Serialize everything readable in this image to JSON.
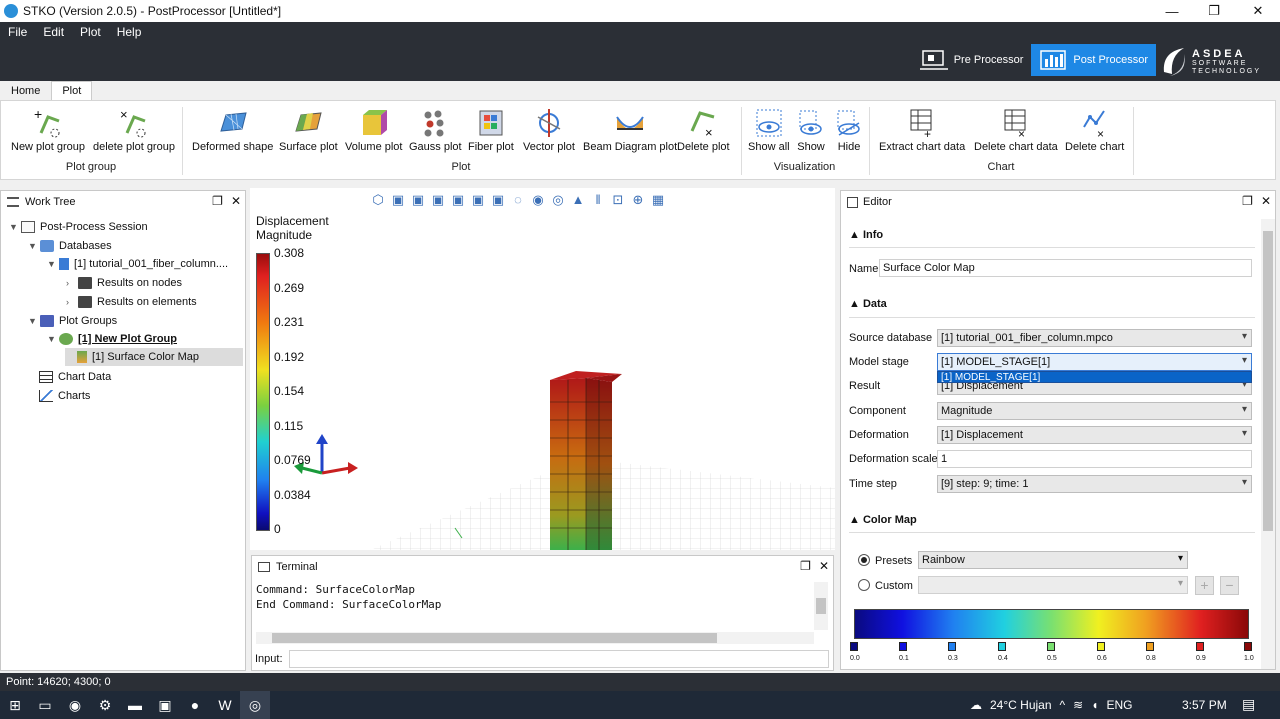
{
  "window": {
    "title": "STKO (Version 2.0.5) - PostProcessor [Untitled*]",
    "min": "—",
    "max": "❐",
    "close": "✕"
  },
  "menu": [
    "File",
    "Edit",
    "Plot",
    "Help"
  ],
  "modes": {
    "pre": "Pre Processor",
    "post": "Post Processor"
  },
  "logo": {
    "brand": "ASDEA",
    "line1": "SOFTWARE",
    "line2": "TECHNOLOGY"
  },
  "ribbon_tabs": [
    "Home",
    "Plot"
  ],
  "ribbon": {
    "groups": [
      "Plot group",
      "Plot",
      "Visualization",
      "Chart"
    ],
    "buttons": [
      "New plot group",
      "delete plot group",
      "Deformed shape",
      "Surface plot",
      "Volume plot",
      "Gauss plot",
      "Fiber plot",
      "Vector plot",
      "Beam Diagram plot",
      "Delete plot",
      "Show all",
      "Show",
      "Hide",
      "Extract chart data",
      "Delete chart data",
      "Delete chart"
    ]
  },
  "worktree": {
    "title": "Work Tree",
    "nodes": [
      "Post-Process Session",
      "Databases",
      "[1] tutorial_001_fiber_column....",
      "Results on nodes",
      "Results on elements",
      "Plot Groups",
      "[1] New Plot Group",
      "[1] Surface Color Map",
      "Chart Data",
      "Charts"
    ]
  },
  "legend": {
    "title1": "Displacement",
    "title2": "Magnitude",
    "ticks": [
      "0.308",
      "0.269",
      "0.231",
      "0.192",
      "0.154",
      "0.115",
      "0.0769",
      "0.0384",
      "0"
    ]
  },
  "terminal": {
    "title": "Terminal",
    "lines": [
      "Command: SurfaceColorMap",
      "End Command: SurfaceColorMap"
    ],
    "input_label": "Input:"
  },
  "editor": {
    "title": "Editor",
    "info": "Info",
    "name_label": "Name",
    "name_value": "Surface Color Map",
    "data": "Data",
    "source_db_label": "Source database",
    "source_db": "[1] tutorial_001_fiber_column.mpco",
    "model_stage_label": "Model stage",
    "model_stage": "[1] MODEL_STAGE[1]",
    "dropdown_option": "[1] MODEL_STAGE[1]",
    "result_label": "Result",
    "result": "[1] Displacement",
    "component_label": "Component",
    "component": "Magnitude",
    "deformation_label": "Deformation",
    "deformation": "[1] Displacement",
    "def_scale_label": "Deformation scale",
    "def_scale": "1",
    "timestep_label": "Time step",
    "timestep": "[9] step: 9; time: 1",
    "colormap": "Color Map",
    "presets_label": "Presets",
    "presets_value": "Rainbow",
    "custom_label": "Custom",
    "cmap_ticks": [
      "0.0",
      "0.1",
      "0.3",
      "0.4",
      "0.5",
      "0.6",
      "0.8",
      "0.9",
      "1.0"
    ]
  },
  "status": "Point: 14620; 4300; 0",
  "taskbar": {
    "weather": "24°C Hujan",
    "lang": "ENG",
    "time": "3:57 PM"
  }
}
